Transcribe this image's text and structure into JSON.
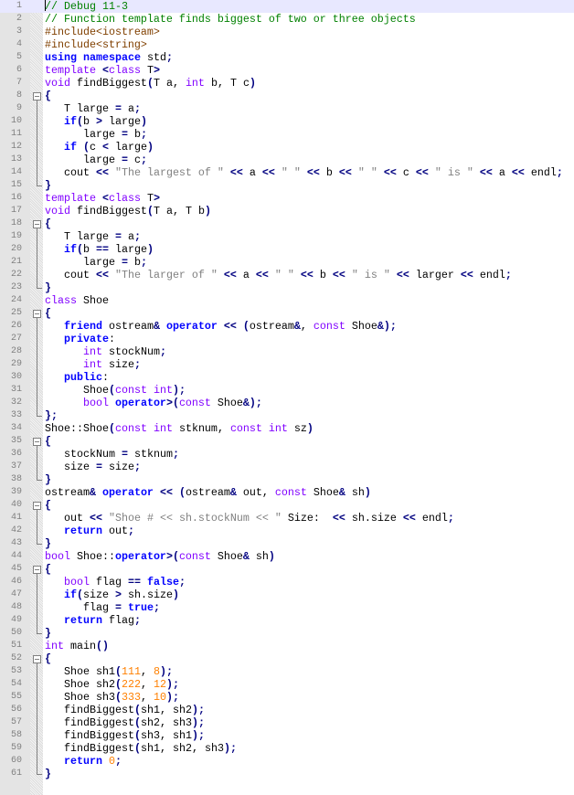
{
  "editor": {
    "current_line": 1,
    "lines": [
      "// Debug 11-3",
      "// Function template finds biggest of two or three objects",
      "#include<iostream>",
      "#include<string>",
      "using namespace std;",
      "template <class T>",
      "void findBiggest(T a, int b, T c)",
      "{",
      "   T large = a;",
      "   if(b > large)",
      "      large = b;",
      "   if (c < large)",
      "      large = c;",
      "   cout << \"The largest of \" << a << \" \" << b << \" \" << c << \" is \" << a << endl;",
      "}",
      "template <class T>",
      "void findBiggest(T a, T b)",
      "{",
      "   T large = a;",
      "   if(b == large)",
      "      large = b;",
      "   cout << \"The larger of \" << a << \" \" << b << \" is \" << larger << endl;",
      "}",
      "class Shoe",
      "{",
      "   friend ostream& operator << (ostream&, const Shoe&);",
      "   private:",
      "      int stockNum;",
      "      int size;",
      "   public:",
      "      Shoe(const int);",
      "      bool operator>(const Shoe&);",
      "};",
      "Shoe::Shoe(const int stknum, const int sz)",
      "{",
      "   stockNum = stknum;",
      "   size = size;",
      "}",
      "ostream& operator << (ostream& out, const Shoe& sh)",
      "{",
      "   out << \"Shoe # << sh.stockNum << \" Size:  << sh.size << endl;",
      "   return out;",
      "}",
      "bool Shoe::operator>(const Shoe& sh)",
      "{",
      "   bool flag == false;",
      "   if(size > sh.size)",
      "      flag = true;",
      "   return flag;",
      "}",
      "int main()",
      "{",
      "   Shoe sh1(111, 8);",
      "   Shoe sh2(222, 12);",
      "   Shoe sh3(333, 10);",
      "   findBiggest(sh1, sh2);",
      "   findBiggest(sh2, sh3);",
      "   findBiggest(sh3, sh1);",
      "   findBiggest(sh1, sh2, sh3);",
      "   return 0;",
      "}"
    ]
  },
  "colors": {
    "comment": "#008000",
    "preprocessor": "#804000",
    "keyword": "#0000ff",
    "type": "#8000ff",
    "string": "#808080",
    "number": "#ff8000",
    "operator": "#000080",
    "current_line_bg": "#e8e8ff"
  }
}
